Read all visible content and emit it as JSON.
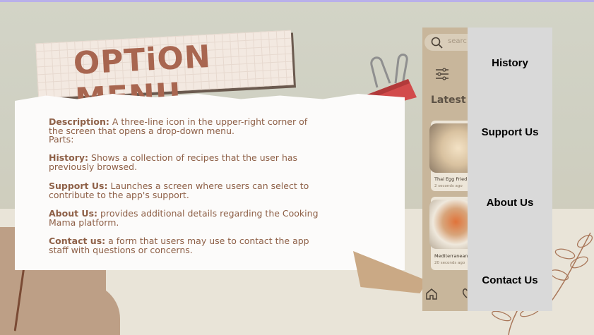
{
  "slide": {
    "title": "OPTiON MENU"
  },
  "description": {
    "desc_heading": "Description:",
    "desc_line1": "A three-line icon in the upper-right corner of",
    "desc_line2": "the screen that opens a drop-down menu.",
    "parts": "Parts:",
    "history_heading": "History:",
    "history_line1": "Shows a collection of recipes that the user has",
    "history_line2": "previously browsed.",
    "support_heading": "Support Us:",
    "support_line1": "Launches a screen where users can select to",
    "support_line2": "contribute to the app's support.",
    "about_heading": "About Us:",
    "about_line1": "provides additional details regarding the Cooking",
    "about_line2": "Mama platform.",
    "contact_heading": "Contact us:",
    "contact_line1": "a form that users may use to contact the app",
    "contact_line2": "staff with questions or concerns."
  },
  "phone": {
    "search_placeholder": "searc",
    "latest_heading": "Latest R",
    "cards": [
      {
        "name": "Thai Egg Fried R",
        "time": "2 seconds ago"
      },
      {
        "name": "Mediterranean I",
        "time": "20 seconds ago"
      }
    ],
    "icons": [
      "search-icon",
      "filter-icon",
      "home-icon",
      "heart-icon"
    ]
  },
  "dropdown": {
    "items": [
      "History",
      "Support Us",
      "About Us",
      "Contact Us"
    ]
  },
  "colors": {
    "title": "#a86650",
    "body_text": "#8e6047",
    "dropdown_bg": "#d9d9d9",
    "phone_bg": "#c8b69b"
  }
}
